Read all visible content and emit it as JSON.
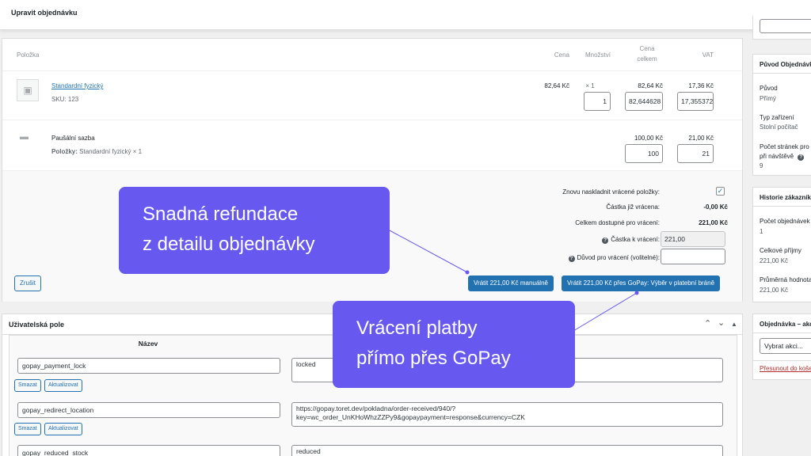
{
  "header": {
    "title": "Upravit objednávku"
  },
  "items_table": {
    "headers": {
      "item": "Položka",
      "price": "Cena",
      "qty": "Množství",
      "total_line1": "Cena",
      "total_line2": "celkem",
      "vat": "VAT"
    },
    "product": {
      "name": "Standardní fyzický",
      "sku_label": "SKU:",
      "sku": "123",
      "price": "82,64 Kč",
      "qty": "× 1",
      "total": "82,64 Kč",
      "vat": "17,36 Kč",
      "qty_input": "1",
      "total_input": "82,644628",
      "vat_input": "17,355372"
    },
    "shipping": {
      "name": "Paušální sazba",
      "items_label": "Položky:",
      "items_value": "Standardní fyzický × 1",
      "total": "100,00 Kč",
      "vat": "21,00 Kč",
      "total_input": "100",
      "vat_input": "21"
    }
  },
  "refund": {
    "restock_label": "Znovu naskladnit vrácené položky:",
    "already_refunded_label": "Částka již vrácena:",
    "already_refunded_value": "-0,00 Kč",
    "available_label": "Celkem dostupné pro vrácení:",
    "available_value": "221,00 Kč",
    "amount_label": "Částka k vrácení:",
    "amount_value": "221,00",
    "reason_label": "Důvod pro vrácení (volitelné):",
    "reason_value": "",
    "help_glyph": "?",
    "cancel_button": "Zrušit",
    "manual_button": "Vrátit 221,00 Kč manuálně",
    "gateway_button": "Vrátit 221,00 Kč přes GoPay: Výběr v platební bráně"
  },
  "custom_fields": {
    "title": "Uživatelská pole",
    "name_header": "Název",
    "delete_label": "Smazat",
    "update_label": "Aktualizovat",
    "rows": [
      {
        "key": "gopay_payment_lock",
        "value": "locked"
      },
      {
        "key": "gopay_redirect_location",
        "value_line1": "https://gopay.toret.dev/pokladna/order-received/940/?",
        "value_line2": "key=wc_order_UnKHoWhzZZPy9&gopaypayment=response&currency=CZK"
      },
      {
        "key": "gopay_reduced_stock",
        "value": "reduced"
      }
    ]
  },
  "sidebar": {
    "origin": {
      "title": "Původ Objednávky",
      "source_label": "Původ",
      "source_value": "Přímý",
      "device_label": "Typ zařízení",
      "device_value": "Stolní počítač",
      "pages_label_1": "Počet stránek pro",
      "pages_label_2": "při návštěvě",
      "pages_value": "9"
    },
    "history": {
      "title": "Historie zákazníka",
      "orders_label": "Počet objednávek",
      "orders_value": "1",
      "revenue_label": "Celkové příjmy",
      "revenue_value": "221,00 Kč",
      "avg_label": "Průměrná hodnota",
      "avg_value": "221,00 Kč"
    },
    "actions": {
      "title": "Objednávka – akce",
      "select_value": "Vybrat akci...",
      "trash_link": "Přesunout do koše"
    }
  },
  "callouts": {
    "refund": {
      "line1": "Snadná refundace",
      "line2": "z detailu objednávky"
    },
    "gopay": {
      "line1": "Vrácení platby",
      "line2": "přímo přes GoPay"
    }
  },
  "colors": {
    "accent": "#2271b1",
    "callout": "#6759f0"
  }
}
